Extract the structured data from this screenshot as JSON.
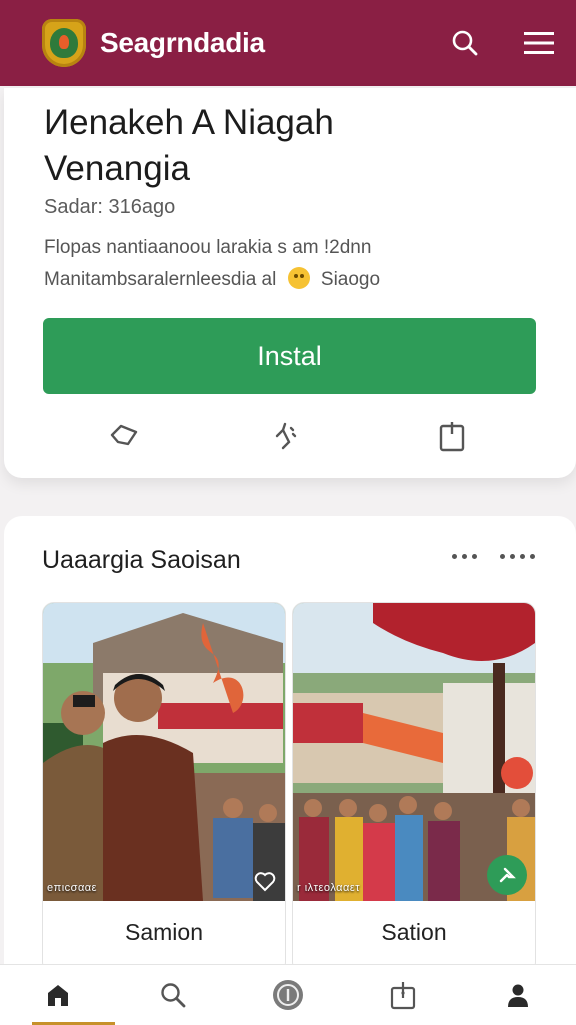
{
  "header": {
    "brand": "Seagrndadia",
    "icons": [
      "search-icon",
      "menu-icon"
    ]
  },
  "app": {
    "title_line1": "Иenakeh  A  Niagah",
    "title_line2": "Venangia",
    "subtitle": "Sadar: 316ago",
    "desc_line1": "Flopas nantiaanoou larakia s  am  !2dnn",
    "desc_line2_a": "Manitambsaralernleesdia al",
    "desc_line2_b": "Siaogo",
    "install_label": "Instal",
    "action_icons": [
      "share-icon",
      "sparkle-icon",
      "bookmark-icon"
    ]
  },
  "gallery": {
    "title": "Uaaargia Saoisan",
    "items": [
      {
        "caption": "eπιcσααε",
        "label": "Samion"
      },
      {
        "caption": "r ιλτεολααετ",
        "label": "Sation"
      }
    ]
  },
  "nav": {
    "items": [
      "home-icon",
      "search-icon",
      "info-circle-icon",
      "share-box-icon",
      "profile-icon"
    ],
    "active": "home-icon"
  },
  "colors": {
    "header": "#8a1f44",
    "accent": "#2e9c58",
    "nav_active": "#c7912a"
  }
}
